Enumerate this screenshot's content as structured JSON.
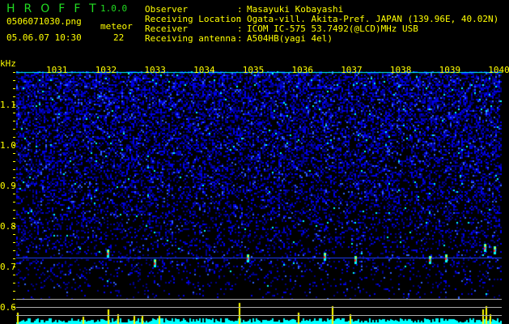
{
  "header": {
    "app_name": "HROFFT",
    "version": "1.0.0",
    "filename": "0506071030.png",
    "datetime": "05.06.07 10:30",
    "meteor_label": "meteor",
    "meteor_count": "22"
  },
  "info": [
    {
      "label": "Observer",
      "value": "Masayuki Kobayashi"
    },
    {
      "label": "Receiving Location",
      "value": "Ogata-vill. Akita-Pref. JAPAN (139.96E, 40.02N)"
    },
    {
      "label": "Receiver",
      "value": "ICOM IC-575 53.7492(@LCD)MHz USB"
    },
    {
      "label": "Receiving antenna",
      "value": "A504HB(yagi 4el)"
    }
  ],
  "spectrogram": {
    "y_unit": "kHz",
    "y_ticks": [
      "1.1",
      "1.0",
      "0.9",
      "0.8",
      "0.7",
      "0.6"
    ],
    "x_ticks": [
      "1031",
      "1032",
      "1033",
      "1034",
      "1035",
      "1036",
      "1037",
      "1038",
      "1039",
      "1040"
    ],
    "colors": {
      "background": "#000000",
      "noise": "#0000ff",
      "echo_low": "#00ffff",
      "echo_high": "#ff0000",
      "histogram": "#00ffff",
      "meteor_marker": "#ffff00",
      "text": "#ffff00"
    }
  }
}
